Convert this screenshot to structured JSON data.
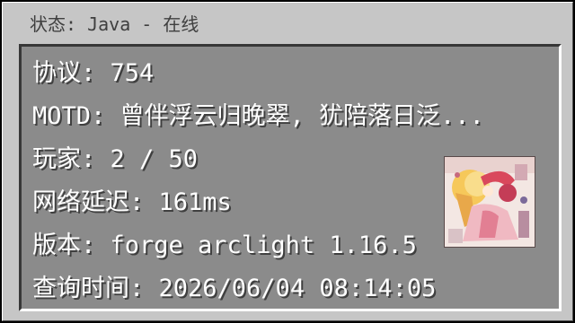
{
  "window": {
    "title": "状态: Java - 在线"
  },
  "server": {
    "protocol_label": "协议: ",
    "protocol_value": "754",
    "motd_label": "MOTD: ",
    "motd_value": "曾伴浮云归晚翠, 犹陪落日泛...",
    "players_label": "玩家: ",
    "players_value": "2 / 50",
    "latency_label": "网络延迟: ",
    "latency_value": "161ms",
    "version_label": "版本: ",
    "version_value": "forge arclight 1.16.5",
    "query_time_label": "查询时间: ",
    "query_time_value": "2026/06/04 08:14:05"
  },
  "favicon": {
    "icon": "server-favicon-image"
  },
  "colors": {
    "panel_bg": "#c6c6c6",
    "content_bg": "#8b8b8b",
    "text": "#ffffff",
    "title_text": "#3f3f3f"
  }
}
